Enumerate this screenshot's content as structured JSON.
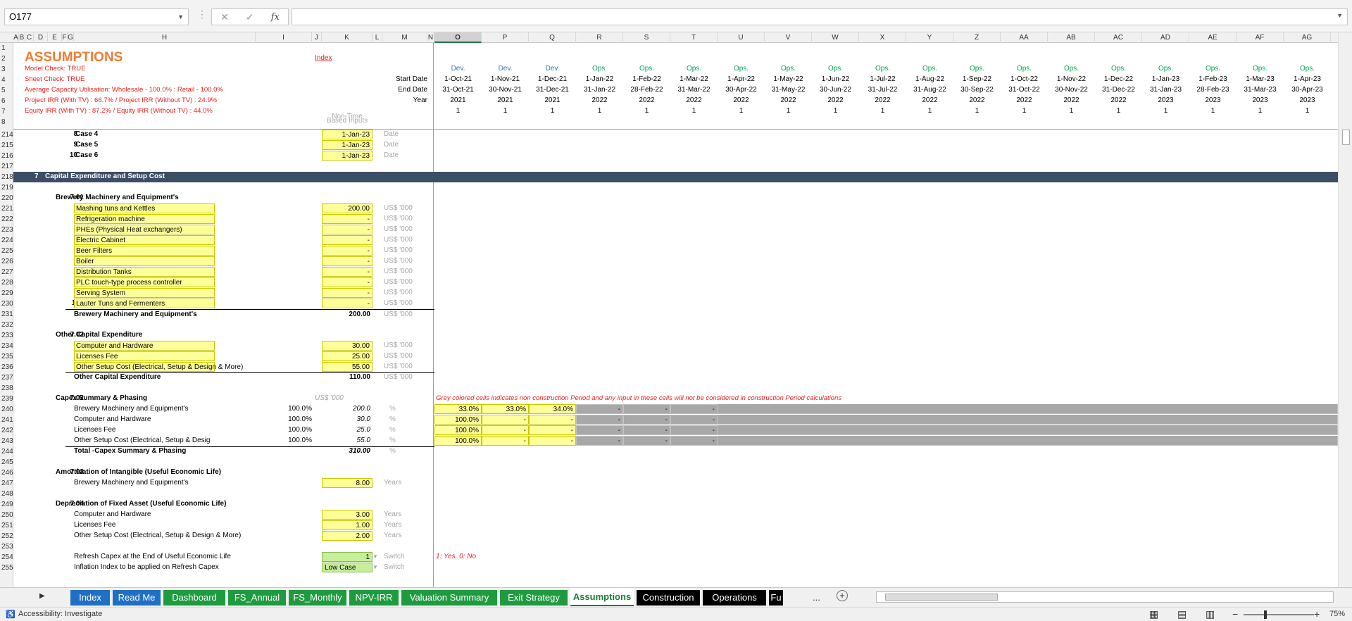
{
  "formula_bar": {
    "name_box": "O177",
    "formula": ""
  },
  "columns": [
    "A",
    "B",
    "C",
    "D",
    "E",
    "F",
    "G",
    "H",
    "I",
    "J",
    "K",
    "L",
    "M",
    "N",
    "O",
    "P",
    "Q",
    "R",
    "S",
    "T",
    "U",
    "V",
    "W",
    "X",
    "Y",
    "Z",
    "AA",
    "AB",
    "AC",
    "AD",
    "AE",
    "AF",
    "AG"
  ],
  "rows": [
    "1",
    "2",
    "3",
    "4",
    "5",
    "6",
    "7",
    "8",
    "214",
    "215",
    "216",
    "217",
    "218",
    "219",
    "220",
    "221",
    "222",
    "223",
    "224",
    "225",
    "226",
    "227",
    "228",
    "229",
    "230",
    "231",
    "232",
    "233",
    "234",
    "235",
    "236",
    "237",
    "238",
    "239",
    "240",
    "241",
    "242",
    "243",
    "244",
    "245",
    "246",
    "247",
    "248",
    "249",
    "250",
    "251",
    "252",
    "253",
    "254",
    "255"
  ],
  "header": {
    "title": "ASSUMPTIONS",
    "index_link": "Index",
    "checks": [
      "Model Check: TRUE",
      "Sheet Check: TRUE",
      "Average Capacity Utilisation: Wholesale - 100.0% : Retail - 100.0%",
      "Project IRR (With TV) : 66.7% / Project IRR (Without TV) : 24.9%",
      "Equity IRR (With TV) : 87.2% / Equity IRR (Without TV) : 44.0%"
    ],
    "row_labels": {
      "start": "Start Date",
      "end": "End Date",
      "year": "Year"
    },
    "non_time_label": "Non-Time",
    "based_inputs_label": "Based Inputs"
  },
  "timeline": [
    {
      "phase": "Dev.",
      "start": "1-Oct-21",
      "end": "31-Oct-21",
      "year": "2021",
      "flag": "1"
    },
    {
      "phase": "Dev.",
      "start": "1-Nov-21",
      "end": "30-Nov-21",
      "year": "2021",
      "flag": "1"
    },
    {
      "phase": "Dev.",
      "start": "1-Dec-21",
      "end": "31-Dec-21",
      "year": "2021",
      "flag": "1"
    },
    {
      "phase": "Ops.",
      "start": "1-Jan-22",
      "end": "31-Jan-22",
      "year": "2022",
      "flag": "1"
    },
    {
      "phase": "Ops.",
      "start": "1-Feb-22",
      "end": "28-Feb-22",
      "year": "2022",
      "flag": "1"
    },
    {
      "phase": "Ops.",
      "start": "1-Mar-22",
      "end": "31-Mar-22",
      "year": "2022",
      "flag": "1"
    },
    {
      "phase": "Ops.",
      "start": "1-Apr-22",
      "end": "30-Apr-22",
      "year": "2022",
      "flag": "1"
    },
    {
      "phase": "Ops.",
      "start": "1-May-22",
      "end": "31-May-22",
      "year": "2022",
      "flag": "1"
    },
    {
      "phase": "Ops.",
      "start": "1-Jun-22",
      "end": "30-Jun-22",
      "year": "2022",
      "flag": "1"
    },
    {
      "phase": "Ops.",
      "start": "1-Jul-22",
      "end": "31-Jul-22",
      "year": "2022",
      "flag": "1"
    },
    {
      "phase": "Ops.",
      "start": "1-Aug-22",
      "end": "31-Aug-22",
      "year": "2022",
      "flag": "1"
    },
    {
      "phase": "Ops.",
      "start": "1-Sep-22",
      "end": "30-Sep-22",
      "year": "2022",
      "flag": "1"
    },
    {
      "phase": "Ops.",
      "start": "1-Oct-22",
      "end": "31-Oct-22",
      "year": "2022",
      "flag": "1"
    },
    {
      "phase": "Ops.",
      "start": "1-Nov-22",
      "end": "30-Nov-22",
      "year": "2022",
      "flag": "1"
    },
    {
      "phase": "Ops.",
      "start": "1-Dec-22",
      "end": "31-Dec-22",
      "year": "2022",
      "flag": "1"
    },
    {
      "phase": "Ops.",
      "start": "1-Jan-23",
      "end": "31-Jan-23",
      "year": "2023",
      "flag": "1"
    },
    {
      "phase": "Ops.",
      "start": "1-Feb-23",
      "end": "28-Feb-23",
      "year": "2023",
      "flag": "1"
    },
    {
      "phase": "Ops.",
      "start": "1-Mar-23",
      "end": "31-Mar-23",
      "year": "2023",
      "flag": "1"
    },
    {
      "phase": "Ops.",
      "start": "1-Apr-23",
      "end": "30-Apr-23",
      "year": "2023",
      "flag": "1"
    }
  ],
  "cases": [
    {
      "n": "8",
      "label": "Case 4",
      "value": "1-Jan-23",
      "unit": "Date"
    },
    {
      "n": "9",
      "label": "Case 5",
      "value": "1-Jan-23",
      "unit": "Date"
    },
    {
      "n": "10",
      "label": "Case 6",
      "value": "1-Jan-23",
      "unit": "Date"
    }
  ],
  "section7": {
    "num": "7",
    "title": "Capital Expenditure and Setup Cost"
  },
  "s701": {
    "num": "7.01",
    "title": "Brewery Machinery and Equipment's",
    "items": [
      {
        "n": "1",
        "label": "Mashing tuns and Kettles",
        "value": "200.00",
        "unit": "US$ '000"
      },
      {
        "n": "2",
        "label": "Refrigeration machine",
        "value": "-",
        "unit": "US$ '000"
      },
      {
        "n": "3",
        "label": "PHEs (Physical Heat exchangers)",
        "value": "-",
        "unit": "US$ '000"
      },
      {
        "n": "4",
        "label": "Electric Cabinet",
        "value": "-",
        "unit": "US$ '000"
      },
      {
        "n": "5",
        "label": "Beer Filters",
        "value": "-",
        "unit": "US$ '000"
      },
      {
        "n": "6",
        "label": "Boiler",
        "value": "-",
        "unit": "US$ '000"
      },
      {
        "n": "7",
        "label": "Distribution Tanks",
        "value": "-",
        "unit": "US$ '000"
      },
      {
        "n": "8",
        "label": "PLC touch-type process controller",
        "value": "-",
        "unit": "US$ '000"
      },
      {
        "n": "9",
        "label": "Serving System",
        "value": "-",
        "unit": "US$ '000"
      },
      {
        "n": "10",
        "label": "Lauter Tuns and Fermenters",
        "value": "-",
        "unit": "US$ '000"
      }
    ],
    "total": {
      "label": "Brewery Machinery and Equipment's",
      "value": "200.00",
      "unit": "US$ '000"
    }
  },
  "s702": {
    "num": "7.02",
    "title": "Other Capital Expenditure",
    "items": [
      {
        "label": "Computer and Hardware",
        "value": "30.00",
        "unit": "US$ '000"
      },
      {
        "label": "Licenses Fee",
        "value": "25.00",
        "unit": "US$ '000"
      },
      {
        "label": "Other Setup Cost (Electrical, Setup & Design & More)",
        "value": "55.00",
        "unit": "US$ '000"
      }
    ],
    "total": {
      "label": "Other Capital Expenditure",
      "value": "110.00",
      "unit": "US$ '000"
    }
  },
  "s702b": {
    "num": "7.02",
    "title": "Capex Summary & Phasing",
    "unit_header": "US$ '000",
    "note": "Grey colored cells indicates non construction Period and any input in these cells will not be considered in construction Period calculations",
    "items": [
      {
        "label": "Brewery Machinery and Equipment's",
        "pct": "100.0%",
        "value": "200.0",
        "unit": "%",
        "phasing": [
          "33.0%",
          "33.0%",
          "34.0%",
          "-",
          "-",
          "-"
        ]
      },
      {
        "label": "Computer and Hardware",
        "pct": "100.0%",
        "value": "30.0",
        "unit": "%",
        "phasing": [
          "100.0%",
          "-",
          "-",
          "-",
          "-",
          "-"
        ]
      },
      {
        "label": "Licenses Fee",
        "pct": "100.0%",
        "value": "25.0",
        "unit": "%",
        "phasing": [
          "100.0%",
          "-",
          "-",
          "-",
          "-",
          "-"
        ]
      },
      {
        "label": "Other Setup Cost (Electrical, Setup & Desig",
        "pct": "100.0%",
        "value": "55.0",
        "unit": "%",
        "phasing": [
          "100.0%",
          "-",
          "-",
          "-",
          "-",
          "-"
        ]
      }
    ],
    "total": {
      "label": "Total -Capex Summary & Phasing",
      "value": "310.00",
      "unit": "%"
    }
  },
  "s703": {
    "num": "7.03",
    "title": "Amortisation of Intangible (Useful Economic Life)",
    "items": [
      {
        "label": "Brewery Machinery and Equipment's",
        "value": "8.00",
        "unit": "Years"
      }
    ]
  },
  "s704": {
    "num": "7.04",
    "title": "Depreciation of Fixed Asset (Useful Economic Life)",
    "items": [
      {
        "label": "Computer and Hardware",
        "value": "3.00",
        "unit": "Years"
      },
      {
        "label": "Licenses Fee",
        "value": "1.00",
        "unit": "Years"
      },
      {
        "label": "Other Setup Cost (Electrical, Setup & Design & More)",
        "value": "2.00",
        "unit": "Years"
      }
    ]
  },
  "refresh": [
    {
      "label": "Refresh Capex at the End of Useful Economic Life",
      "value": "1",
      "unit": "Switch",
      "note": "1: Yes, 0: No"
    },
    {
      "label": "Inflation Index to be applied on Refresh Capex",
      "value": "Low Case",
      "unit": "Switch"
    }
  ],
  "tabs": [
    {
      "label": "Index",
      "bg": "#1f6fc5",
      "color": "#ffffff"
    },
    {
      "label": "Read Me",
      "bg": "#1f6fc5",
      "color": "#ffffff"
    },
    {
      "label": "Dashboard",
      "bg": "#1f9b3f",
      "color": "#ffffff"
    },
    {
      "label": "FS_Annual",
      "bg": "#1f9b3f",
      "color": "#ffffff"
    },
    {
      "label": "FS_Monthly",
      "bg": "#1f9b3f",
      "color": "#ffffff"
    },
    {
      "label": "NPV-IRR",
      "bg": "#1f9b3f",
      "color": "#ffffff"
    },
    {
      "label": "Valuation Summary",
      "bg": "#1f9b3f",
      "color": "#ffffff"
    },
    {
      "label": "Exit Strategy",
      "bg": "#1f9b3f",
      "color": "#ffffff"
    },
    {
      "label": "Assumptions",
      "bg": "#ffffff",
      "color": "#1e7a3a"
    },
    {
      "label": "Construction",
      "bg": "#000000",
      "color": "#ffffff"
    },
    {
      "label": "Operations",
      "bg": "#000000",
      "color": "#ffffff"
    },
    {
      "label": "Fu",
      "bg": "#000000",
      "color": "#ffffff"
    }
  ],
  "tab_more": "...",
  "status": {
    "accessibility": "Accessibility: Investigate",
    "zoom": "75%"
  }
}
